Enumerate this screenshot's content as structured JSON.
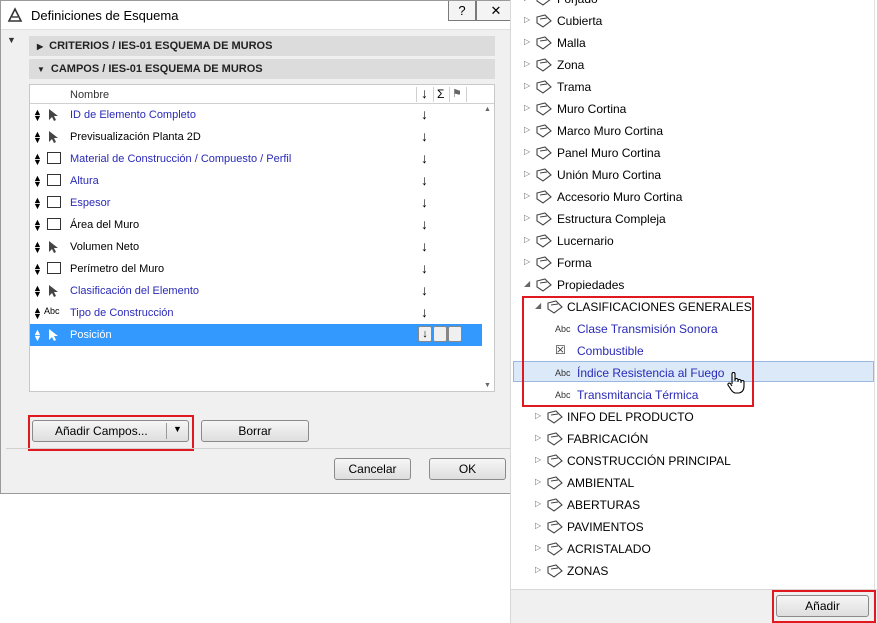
{
  "dialog": {
    "title": "Definiciones de Esquema",
    "help_label": "?",
    "close_label": "✕",
    "sections": [
      {
        "label": "CRITERIOS / IES-01 ESQUEMA DE MUROS",
        "expanded": false
      },
      {
        "label": "CAMPOS / IES-01 ESQUEMA DE MUROS",
        "expanded": true
      }
    ],
    "list_header": {
      "name": "Nombre",
      "sort": "↓",
      "sum": "Σ",
      "flag": "⚑"
    },
    "rows": [
      {
        "label": "ID de Elemento Completo",
        "icon": "arrow-pointer-icon",
        "blue": true
      },
      {
        "label": "Previsualización Planta 2D",
        "icon": "arrow-pointer-icon",
        "blue": false
      },
      {
        "label": "Material de Construcción / Compuesto / Perfil",
        "icon": "box-icon",
        "blue": true
      },
      {
        "label": "Altura",
        "icon": "box-icon",
        "blue": true
      },
      {
        "label": "Espesor",
        "icon": "box-icon",
        "blue": true
      },
      {
        "label": "Área del Muro",
        "icon": "box-icon",
        "blue": false
      },
      {
        "label": "Volumen Neto",
        "icon": "arrow-pointer-icon",
        "blue": false
      },
      {
        "label": "Perímetro del Muro",
        "icon": "box-icon",
        "blue": false
      },
      {
        "label": "Clasificación del Elemento",
        "icon": "arrow-pointer-icon",
        "blue": true
      },
      {
        "label": "Tipo de Construcción",
        "icon": "abc-icon",
        "blue": true
      },
      {
        "label": "Posición",
        "icon": "arrow-pointer-icon",
        "blue": false,
        "selected": true
      }
    ],
    "abc": "Abc",
    "add_fields_label": "Añadir Campos...",
    "delete_label": "Borrar",
    "cancel_label": "Cancelar",
    "ok_label": "OK"
  },
  "panel": {
    "items": [
      {
        "label": "Forjado",
        "level": 0
      },
      {
        "label": "Cubierta",
        "level": 0
      },
      {
        "label": "Malla",
        "level": 0
      },
      {
        "label": "Zona",
        "level": 0
      },
      {
        "label": "Trama",
        "level": 0
      },
      {
        "label": "Muro Cortina",
        "level": 0
      },
      {
        "label": "Marco Muro Cortina",
        "level": 0
      },
      {
        "label": "Panel Muro Cortina",
        "level": 0
      },
      {
        "label": "Unión Muro Cortina",
        "level": 0
      },
      {
        "label": "Accesorio Muro Cortina",
        "level": 0
      },
      {
        "label": "Estructura Compleja",
        "level": 0
      },
      {
        "label": "Lucernario",
        "level": 0
      },
      {
        "label": "Forma",
        "level": 0
      },
      {
        "label": "Propiedades",
        "level": 0,
        "expanded": true
      },
      {
        "label": "CLASIFICACIONES GENERALES",
        "level": 1,
        "expanded": true
      },
      {
        "label": "Clase Transmisión Sonora",
        "level": 2,
        "icon": "Abc"
      },
      {
        "label": "Combustible",
        "level": 2,
        "icon": "☒"
      },
      {
        "label": "Índice Resistencia al Fuego",
        "level": 2,
        "icon": "Abc",
        "hover": true
      },
      {
        "label": "Transmitancia Térmica",
        "level": 2,
        "icon": "Abc"
      },
      {
        "label": "INFO DEL PRODUCTO",
        "level": 1
      },
      {
        "label": "FABRICACIÓN",
        "level": 1
      },
      {
        "label": "CONSTRUCCIÓN PRINCIPAL",
        "level": 1
      },
      {
        "label": "AMBIENTAL",
        "level": 1
      },
      {
        "label": "ABERTURAS",
        "level": 1
      },
      {
        "label": "PAVIMENTOS",
        "level": 1
      },
      {
        "label": "ACRISTALADO",
        "level": 1
      },
      {
        "label": "ZONAS",
        "level": 1
      }
    ],
    "add_label": "Añadir"
  },
  "colors": {
    "highlight": "#e0191e",
    "selection": "#3399ff",
    "link_blue": "#2a2ab8"
  }
}
